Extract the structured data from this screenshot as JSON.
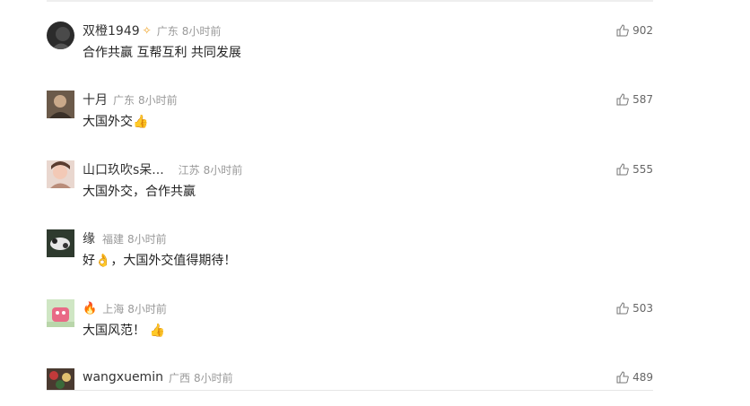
{
  "comments": [
    {
      "user": "双橙1949",
      "badge": "✧",
      "location": "广东",
      "time": "8小时前",
      "text": "合作共赢 互帮互利 共同发展",
      "likes": "902"
    },
    {
      "user": "十月",
      "location": "广东",
      "time": "8小时前",
      "text": "大国外交👍",
      "likes": "587"
    },
    {
      "user": "山口玖吹s呆...",
      "location": "江苏",
      "time": "8小时前",
      "text": "大国外交，合作共赢",
      "likes": "555"
    },
    {
      "user": "缘",
      "location": "福建",
      "time": "8小时前",
      "text": "好👌，大国外交值得期待！",
      "likes": ""
    },
    {
      "user": "🔥",
      "location": "上海",
      "time": "8小时前",
      "text": "大国风范！ 👍",
      "likes": "503"
    },
    {
      "user": "wangxuemin",
      "location": "广西",
      "time": "8小时前",
      "text": "",
      "likes": "489"
    }
  ]
}
